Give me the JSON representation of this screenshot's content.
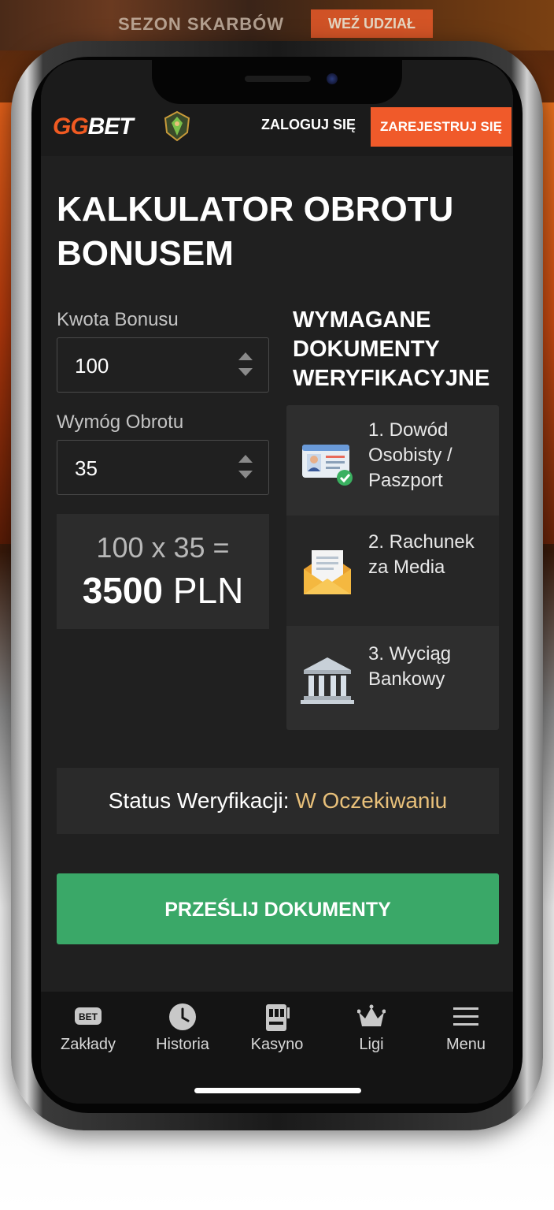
{
  "promo": {
    "title": "SEZON SKARBÓW",
    "button": "WEŹ UDZIAŁ"
  },
  "header": {
    "logo_part1": "GG",
    "logo_part2": "BET",
    "login_label": "ZALOGUJ SIĘ",
    "register_label": "ZAREJESTRUJ SIĘ"
  },
  "page": {
    "title": "KALKULATOR OBROTU BONUSEM"
  },
  "calculator": {
    "bonus_label": "Kwota Bonusu",
    "bonus_value": "100",
    "wager_label": "Wymóg Obrotu",
    "wager_value": "35",
    "equation": "100 x 35 =",
    "total_amount": "3500",
    "currency": "PLN"
  },
  "documents": {
    "title": "WYMAGANE DOKUMENTY WERYFIKACYJNE",
    "items": [
      {
        "label": "1. Dowód Osobisty / Paszport",
        "icon": "id-card-icon"
      },
      {
        "label": "2. Rachunek za Media",
        "icon": "envelope-document-icon"
      },
      {
        "label": "3. Wyciąg Bankowy",
        "icon": "bank-icon"
      }
    ]
  },
  "status": {
    "label": "Status Weryfikacji:",
    "value": "W Oczekiwaniu",
    "value_color": "#e8c07a"
  },
  "submit_label": "PRZEŚLIJ DOKUMENTY",
  "colors": {
    "brand": "#f05a22",
    "accent_green": "#3aa868",
    "background": "#202020"
  },
  "nav": [
    {
      "label": "Zakłady",
      "icon": "bet-icon"
    },
    {
      "label": "Historia",
      "icon": "clock-icon"
    },
    {
      "label": "Kasyno",
      "icon": "slot-machine-icon"
    },
    {
      "label": "Ligi",
      "icon": "crown-icon"
    },
    {
      "label": "Menu",
      "icon": "menu-icon"
    }
  ]
}
